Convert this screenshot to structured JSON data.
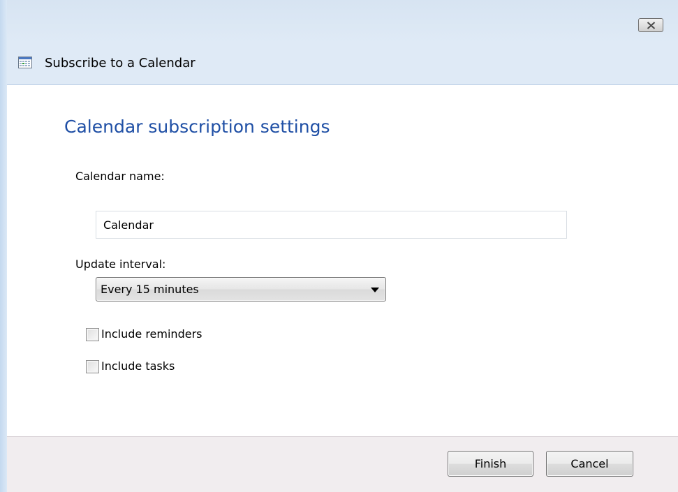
{
  "window": {
    "title_icon": "calendar-icon",
    "header_title": "Subscribe to a Calendar"
  },
  "main": {
    "section_title": "Calendar subscription settings",
    "name_label": "Calendar name:",
    "name_value": "Calendar",
    "interval_label": "Update interval:",
    "interval_value": "Every 15 minutes",
    "checkboxes": [
      {
        "label": "Include reminders",
        "checked": false
      },
      {
        "label": "Include tasks",
        "checked": false
      }
    ]
  },
  "footer": {
    "finish_label": "Finish",
    "cancel_label": "Cancel"
  },
  "colors": {
    "title_blue": "#1f4fa5",
    "header_bg": "#dfeaf6",
    "footer_bg": "#f1edef"
  }
}
